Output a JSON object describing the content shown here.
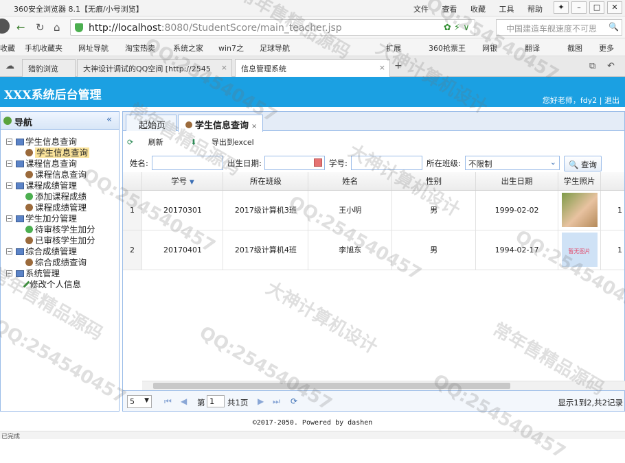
{
  "browser": {
    "title": "360安全浏览器 8.1【无痕/小号浏览】",
    "menu": [
      "文件",
      "查看",
      "收藏",
      "工具",
      "帮助"
    ],
    "url_host": "http://localhost",
    "url_path": ":8080/StudentScore/main_teacher.jsp",
    "search_placeholder": "中国建造车舰速度不可思",
    "bookmarks": [
      "收藏",
      "手机收藏夹",
      "网址导航",
      "淘宝热卖",
      "系统之家",
      "win7之",
      "足球导航",
      "扩展",
      "360抢票王",
      "网银",
      "翻译",
      "截图",
      "更多"
    ],
    "tabs": [
      "猎豹浏览",
      "大神设计调试的QQ空间 [http://2545",
      "信息管理系统"
    ],
    "status_left": "已完成"
  },
  "app": {
    "title": "XXX系统后台管理",
    "user_info": "您好老师，fdy2",
    "logout": "退出"
  },
  "nav": {
    "title": "导航",
    "groups": [
      {
        "label": "学生信息查询",
        "items": [
          "学生信息查询"
        ]
      },
      {
        "label": "课程信息查询",
        "items": [
          "课程信息查询"
        ]
      },
      {
        "label": "课程成绩管理",
        "items": [
          "添加课程成绩",
          "课程成绩管理"
        ]
      },
      {
        "label": "学生加分管理",
        "items": [
          "待审核学生加分",
          "已审核学生加分"
        ]
      },
      {
        "label": "综合成绩管理",
        "items": [
          "综合成绩查询"
        ]
      },
      {
        "label": "系统管理",
        "items": [
          "修改个人信息"
        ]
      }
    ]
  },
  "main": {
    "tabs": [
      "起始页",
      "学生信息查询"
    ],
    "toolbar": {
      "refresh": "刷新",
      "export": "导出到excel"
    },
    "search": {
      "name_label": "姓名:",
      "birth_label": "出生日期:",
      "id_label": "学号:",
      "class_label": "所在班级:",
      "class_value": "不限制",
      "query_button": "查询"
    },
    "columns": [
      "学号",
      "所在班级",
      "姓名",
      "性别",
      "出生日期",
      "学生照片"
    ],
    "rows": [
      {
        "no": "1",
        "id": "20170301",
        "class": "2017级计算机3班",
        "name": "王小明",
        "gender": "男",
        "birth": "1999-02-02",
        "extra": "1"
      },
      {
        "no": "2",
        "id": "20170401",
        "class": "2017级计算机4班",
        "name": "李旭东",
        "gender": "男",
        "birth": "1994-02-17",
        "extra": "1",
        "photo_text": "暂无图片"
      }
    ],
    "pager": {
      "page_size": "5",
      "page_prefix": "第",
      "page_value": "1",
      "page_total": "共1页",
      "display": "显示1到2,共2记录"
    }
  },
  "footer": "©2017-2050. Powered by dashen",
  "watermarks": [
    "QQ:254540457",
    "大神计算机设计",
    "常年售精品源码"
  ]
}
